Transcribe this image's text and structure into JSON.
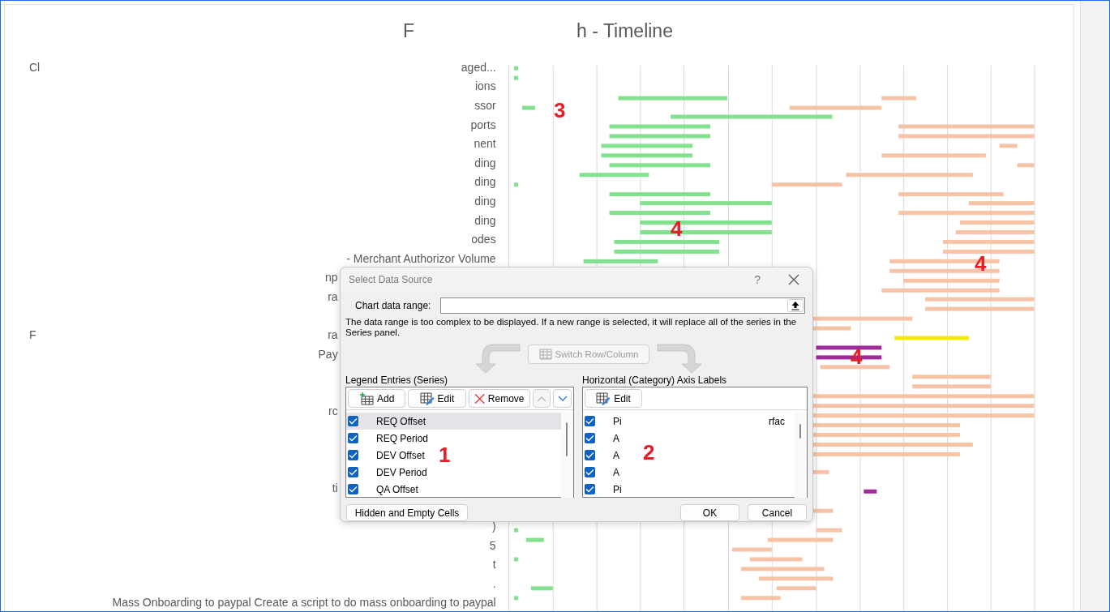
{
  "chart": {
    "title_start": "F",
    "title_end": "h - Timeline",
    "rows": [
      {
        "kind": "full",
        "start": "Cl",
        "end": "aged..."
      },
      {
        "kind": "full",
        "end": "ions"
      },
      {
        "kind": "full",
        "end": "ssor"
      },
      {
        "kind": "full",
        "end": "ports"
      },
      {
        "kind": "full",
        "end": "nent"
      },
      {
        "kind": "full",
        "end": "ding"
      },
      {
        "kind": "full",
        "end": "ding"
      },
      {
        "kind": "full",
        "end": "ding"
      },
      {
        "kind": "full",
        "end": "ding"
      },
      {
        "kind": "full",
        "end": "odes"
      },
      {
        "kind": "full",
        "end": "- Merchant Authorizor Volume"
      },
      {
        "kind": "clipped",
        "end": "np"
      },
      {
        "kind": "clipped",
        "end": "ra"
      },
      {
        "kind": "clipped",
        "start": "F",
        "end": "ra"
      },
      {
        "kind": "clipped",
        "end": "Pay"
      },
      {
        "kind": "clipped",
        "end": "rc"
      },
      {
        "kind": "clipped",
        "end": "ti"
      },
      {
        "kind": "full",
        "end": ")"
      },
      {
        "kind": "full",
        "end": "5"
      },
      {
        "kind": "full",
        "end": "t"
      },
      {
        "kind": "full",
        "end": "."
      },
      {
        "kind": "full",
        "end": "Mass Onboarding to paypal Create a script to do mass onboarding to paypal"
      }
    ]
  },
  "annotations": [
    "3",
    "4",
    "4",
    "4",
    "1",
    "2"
  ],
  "dialog": {
    "title": "Select Data Source",
    "help": "?",
    "range_label": "Chart data range:",
    "message": "The data range is too complex to be displayed. If a new range is selected, it will replace all of the series in the Series panel.",
    "switch_button": {
      "label": "Switch Row/Column",
      "disabled": true
    },
    "legend": {
      "heading": "Legend Entries (Series)",
      "buttons": [
        {
          "kind": "add",
          "label": "Add",
          "disabled": false
        },
        {
          "kind": "edit",
          "label": "Edit",
          "disabled": false
        },
        {
          "kind": "remove",
          "label": "Remove",
          "disabled": false
        },
        {
          "kind": "up",
          "disabled": true
        },
        {
          "kind": "down",
          "disabled": false
        }
      ],
      "series": [
        {
          "name": "REQ Offset",
          "checked": true,
          "selected": true
        },
        {
          "name": "REQ Period",
          "checked": true,
          "selected": false
        },
        {
          "name": "DEV Offset",
          "checked": true,
          "selected": false
        },
        {
          "name": "DEV Period",
          "checked": true,
          "selected": false
        },
        {
          "name": "QA Offset",
          "checked": true,
          "selected": false
        }
      ]
    },
    "axis": {
      "heading": "Horizontal (Category) Axis Labels",
      "edit_button": "Edit",
      "labels": [
        {
          "start": "Pi",
          "end": "rfac",
          "checked": true
        },
        {
          "start": "A",
          "checked": true
        },
        {
          "start": "A",
          "checked": true
        },
        {
          "start": "A",
          "checked": true
        },
        {
          "start": "Pi",
          "checked": true
        }
      ]
    },
    "hidden_button": "Hidden and Empty Cells",
    "ok_button": "OK",
    "cancel_button": "Cancel"
  }
}
